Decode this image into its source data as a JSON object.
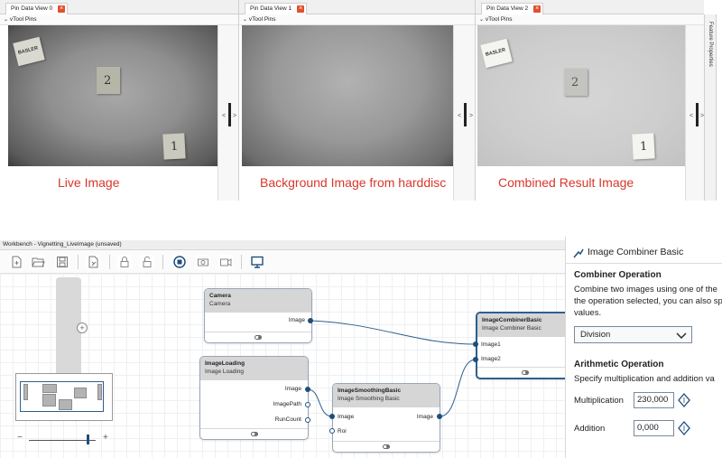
{
  "views": [
    {
      "tab": "Pin Data View 0",
      "subheader": "vTool Pins",
      "caption": "Live Image",
      "note_logo": "BASLER",
      "note_mid": "2",
      "note_low": "1"
    },
    {
      "tab": "Pin Data View 1",
      "subheader": "vTool Pins",
      "caption": "Background Image from harddisc"
    },
    {
      "tab": "Pin Data View 2",
      "subheader": "vTool Pins",
      "caption": "Combined Result Image",
      "note_logo": "BASLER",
      "note_mid": "2",
      "note_low": "1"
    }
  ],
  "side_arrows": {
    "left": "<",
    "right": ">"
  },
  "feature_panel": "Feature Properties",
  "workbench": {
    "title": "Workbench - Vignetting_LiveImage (unsaved)",
    "toolbar_icons": [
      "new-file-icon",
      "open-folder-icon",
      "save-icon",
      "export-icon",
      "lock-icon",
      "unlock-icon",
      "record-icon",
      "camera-snapshot-icon",
      "video-icon",
      "monitor-icon"
    ],
    "nodes": {
      "camera": {
        "title": "Camera",
        "subtitle": "Camera",
        "out1": "Image"
      },
      "loading": {
        "title": "ImageLoading",
        "subtitle": "Image Loading",
        "out1": "Image",
        "out2": "ImagePath",
        "out3": "RunCount"
      },
      "smoothing": {
        "title": "ImageSmoothingBasic",
        "subtitle": "Image Smoothing Basic",
        "in1": "Image",
        "in2": "Roi",
        "out1": "Image"
      },
      "combiner": {
        "title": "ImageCombinerBasic",
        "subtitle": "Image Combiner Basic",
        "in1": "Image1",
        "in2": "Image2"
      }
    },
    "zoom": {
      "minus": "−",
      "plus": "+",
      "level": 0.88
    }
  },
  "properties": {
    "title": "Image Combiner Basic",
    "section1": "Combiner Operation",
    "desc1_line1": "Combine two images using one of the",
    "desc1_line2": "the operation selected, you can also sp",
    "desc1_line3": "values.",
    "operation": "Division",
    "section2": "Arithmetic Operation",
    "desc2": "Specify multiplication and addition va",
    "multiplication_label": "Multiplication",
    "multiplication_value": "230,000",
    "addition_label": "Addition",
    "addition_value": "0,000"
  },
  "colors": {
    "caption_red": "#d9362b",
    "port_blue": "#1f4e7a",
    "wire_blue": "#2e5f8f"
  }
}
